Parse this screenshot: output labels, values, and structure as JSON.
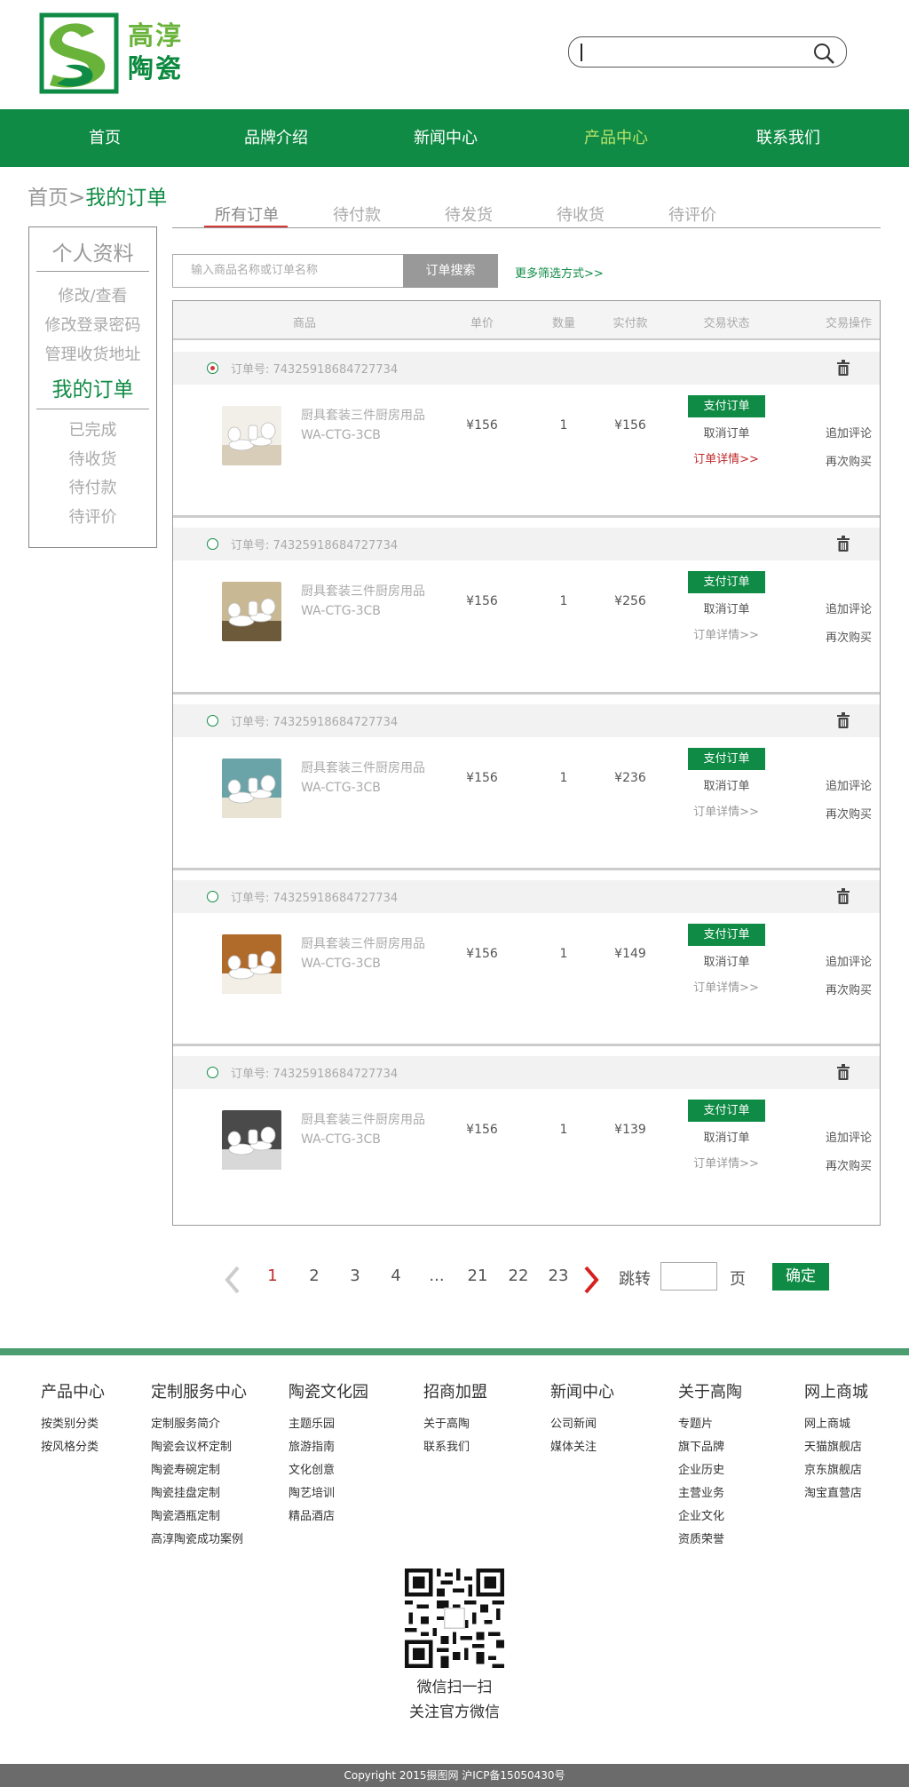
{
  "brand": {
    "name_line1": "高淳",
    "name_line2": "陶瓷"
  },
  "search": {
    "placeholder": ""
  },
  "nav": [
    {
      "label": "首页"
    },
    {
      "label": "品牌介绍"
    },
    {
      "label": "新闻中心"
    },
    {
      "label": "产品中心",
      "active": true
    },
    {
      "label": "联系我们"
    }
  ],
  "breadcrumb": {
    "home": "首页",
    "sep": ">",
    "current": "我的订单"
  },
  "tabs": [
    {
      "label": "所有订单",
      "active": true
    },
    {
      "label": "待付款"
    },
    {
      "label": "待发货"
    },
    {
      "label": "待收货"
    },
    {
      "label": "待评价"
    }
  ],
  "sidebar": {
    "title": "个人资料",
    "items": [
      "修改/查看",
      "修改登录密码",
      "管理收货地址"
    ],
    "section": "我的订单",
    "sub_items": [
      "已完成",
      "待收货",
      "待付款",
      "待评价"
    ]
  },
  "order_search": {
    "placeholder": "输入商品名称或订单名称",
    "button": "订单搜索",
    "more": "更多筛选方式>>"
  },
  "table_headers": [
    "商品",
    "单价",
    "数量",
    "实付款",
    "交易状态",
    "交易操作"
  ],
  "orders": [
    {
      "order_no": "订单号: 74325918684727734",
      "selected": true,
      "name": "厨具套装三件厨房用品",
      "code": "WA-CTG-3CB",
      "price": "¥156",
      "qty": "1",
      "paid": "¥156",
      "pay": "支付订单",
      "cancel": "取消订单",
      "detail": "订单详情>>",
      "detail_highlight": true,
      "review": "追加评论",
      "rebuy": "再次购买"
    },
    {
      "order_no": "订单号: 74325918684727734",
      "selected": false,
      "name": "厨具套装三件厨房用品",
      "code": "WA-CTG-3CB",
      "price": "¥156",
      "qty": "1",
      "paid": "¥256",
      "pay": "支付订单",
      "cancel": "取消订单",
      "detail": "订单详情>>",
      "detail_highlight": false,
      "review": "追加评论",
      "rebuy": "再次购买"
    },
    {
      "order_no": "订单号: 74325918684727734",
      "selected": false,
      "name": "厨具套装三件厨房用品",
      "code": "WA-CTG-3CB",
      "price": "¥156",
      "qty": "1",
      "paid": "¥236",
      "pay": "支付订单",
      "cancel": "取消订单",
      "detail": "订单详情>>",
      "detail_highlight": false,
      "review": "追加评论",
      "rebuy": "再次购买"
    },
    {
      "order_no": "订单号: 74325918684727734",
      "selected": false,
      "name": "厨具套装三件厨房用品",
      "code": "WA-CTG-3CB",
      "price": "¥156",
      "qty": "1",
      "paid": "¥149",
      "pay": "支付订单",
      "cancel": "取消订单",
      "detail": "订单详情>>",
      "detail_highlight": false,
      "review": "追加评论",
      "rebuy": "再次购买"
    },
    {
      "order_no": "订单号: 74325918684727734",
      "selected": false,
      "name": "厨具套装三件厨房用品",
      "code": "WA-CTG-3CB",
      "price": "¥156",
      "qty": "1",
      "paid": "¥139",
      "pay": "支付订单",
      "cancel": "取消订单",
      "detail": "订单详情>>",
      "detail_highlight": false,
      "review": "追加评论",
      "rebuy": "再次购买"
    }
  ],
  "pagination": {
    "pages": [
      "1",
      "2",
      "3",
      "4",
      "...",
      "21",
      "22",
      "23"
    ],
    "current": "1",
    "jump_label": "跳转",
    "page_label": "页",
    "confirm": "确定"
  },
  "footer": {
    "columns": [
      {
        "title": "产品中心",
        "items": [
          "按类别分类",
          "按风格分类"
        ]
      },
      {
        "title": "定制服务中心",
        "items": [
          "定制服务简介",
          "陶瓷会议杯定制",
          "陶瓷寿碗定制",
          "陶瓷挂盘定制",
          "陶瓷酒瓶定制",
          "高淳陶瓷成功案例"
        ]
      },
      {
        "title": "陶瓷文化园",
        "items": [
          "主题乐园",
          "旅游指南",
          "文化创意",
          "陶艺培训",
          "精品酒店"
        ]
      },
      {
        "title": "招商加盟",
        "items": [
          "关于高陶",
          "联系我们"
        ]
      },
      {
        "title": "新闻中心",
        "items": [
          "公司新闻",
          "媒体关注"
        ]
      },
      {
        "title": "关于高陶",
        "items": [
          "专题片",
          "旗下品牌",
          "企业历史",
          "主营业务",
          "企业文化",
          "资质荣誉"
        ]
      },
      {
        "title": "网上商城",
        "items": [
          "网上商城",
          "天猫旗舰店",
          "京东旗舰店",
          "淘宝直营店"
        ]
      }
    ],
    "qr_caption1": "微信扫一扫",
    "qr_caption2": "关注官方微信",
    "copyright": "Copyright 2015摄图网 沪ICP备15050430号"
  },
  "colors": {
    "brand_green": "#0f8b45",
    "accent_red": "#c0282a",
    "nav_active": "#b8e26a"
  }
}
